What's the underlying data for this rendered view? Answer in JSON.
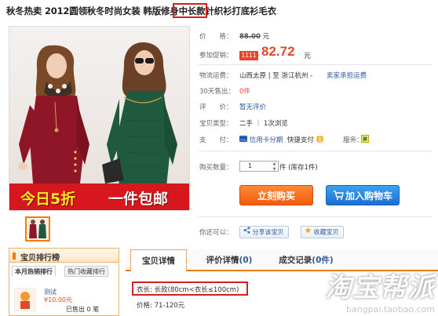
{
  "product": {
    "title_before": "秋冬热卖 2012圆领秋冬时尚女装 韩版修身",
    "title_highlight": "中长款",
    "title_after": "针织衫打底衫毛衣",
    "banner_left": "今日5折",
    "banner_right": "一件包邮"
  },
  "details": {
    "price_label": "价　　格：",
    "orig_price": "88.00",
    "unit": "元",
    "promo_label": "参加促销：",
    "promo_tag": "1111",
    "promo_price": "82.72",
    "promo_unit": "元",
    "shipping_label": "物流运费：",
    "shipping_value": "山西太原 | 至 浙江杭州 -",
    "shipping_note": "卖家承担运费",
    "sold_label": "30天售出：",
    "sold_value": "0件",
    "rating_label": "评　　价：",
    "rating_value": "暂无评价",
    "type_label": "宝贝类型：",
    "type_value": "二手 ｜ 1次浏览",
    "pay_label": "支　　付：",
    "pay_credit": "信用卡分期",
    "pay_quick": "快捷支付",
    "service_label": "服务："
  },
  "purchase": {
    "qty_label": "购买数量：",
    "qty_value": "1",
    "stock_note": "件 (库存1件)",
    "buy_now": "立刻购买",
    "add_cart": "加入购物车",
    "maybe_label": "你还可以：",
    "share": "分享该宝贝",
    "favorite": "收藏宝贝"
  },
  "ranking": {
    "title": "宝贝排行榜",
    "tabs": [
      "本月热销排行",
      "热门收藏排行"
    ],
    "item_name": "测试",
    "item_price": "10.00元",
    "item_sold": "已售出 0 笔"
  },
  "tabs": {
    "details": "宝贝详情",
    "reviews": "评价详情",
    "reviews_count": "(0)",
    "records": "成交记录",
    "records_count": "(0件)"
  },
  "attributes": {
    "length": "衣长: 长款(80cm<衣长≤100cm)",
    "price_range": "价格: 71-120元"
  },
  "watermark": {
    "logo": "淘宝帮派",
    "url": "bangpai.taobao.com"
  },
  "colors": {
    "accent_orange": "#f25b0a",
    "price_red": "#e8452c",
    "cart_blue": "#1b6fd1",
    "highlight_red": "#d21f1f"
  }
}
